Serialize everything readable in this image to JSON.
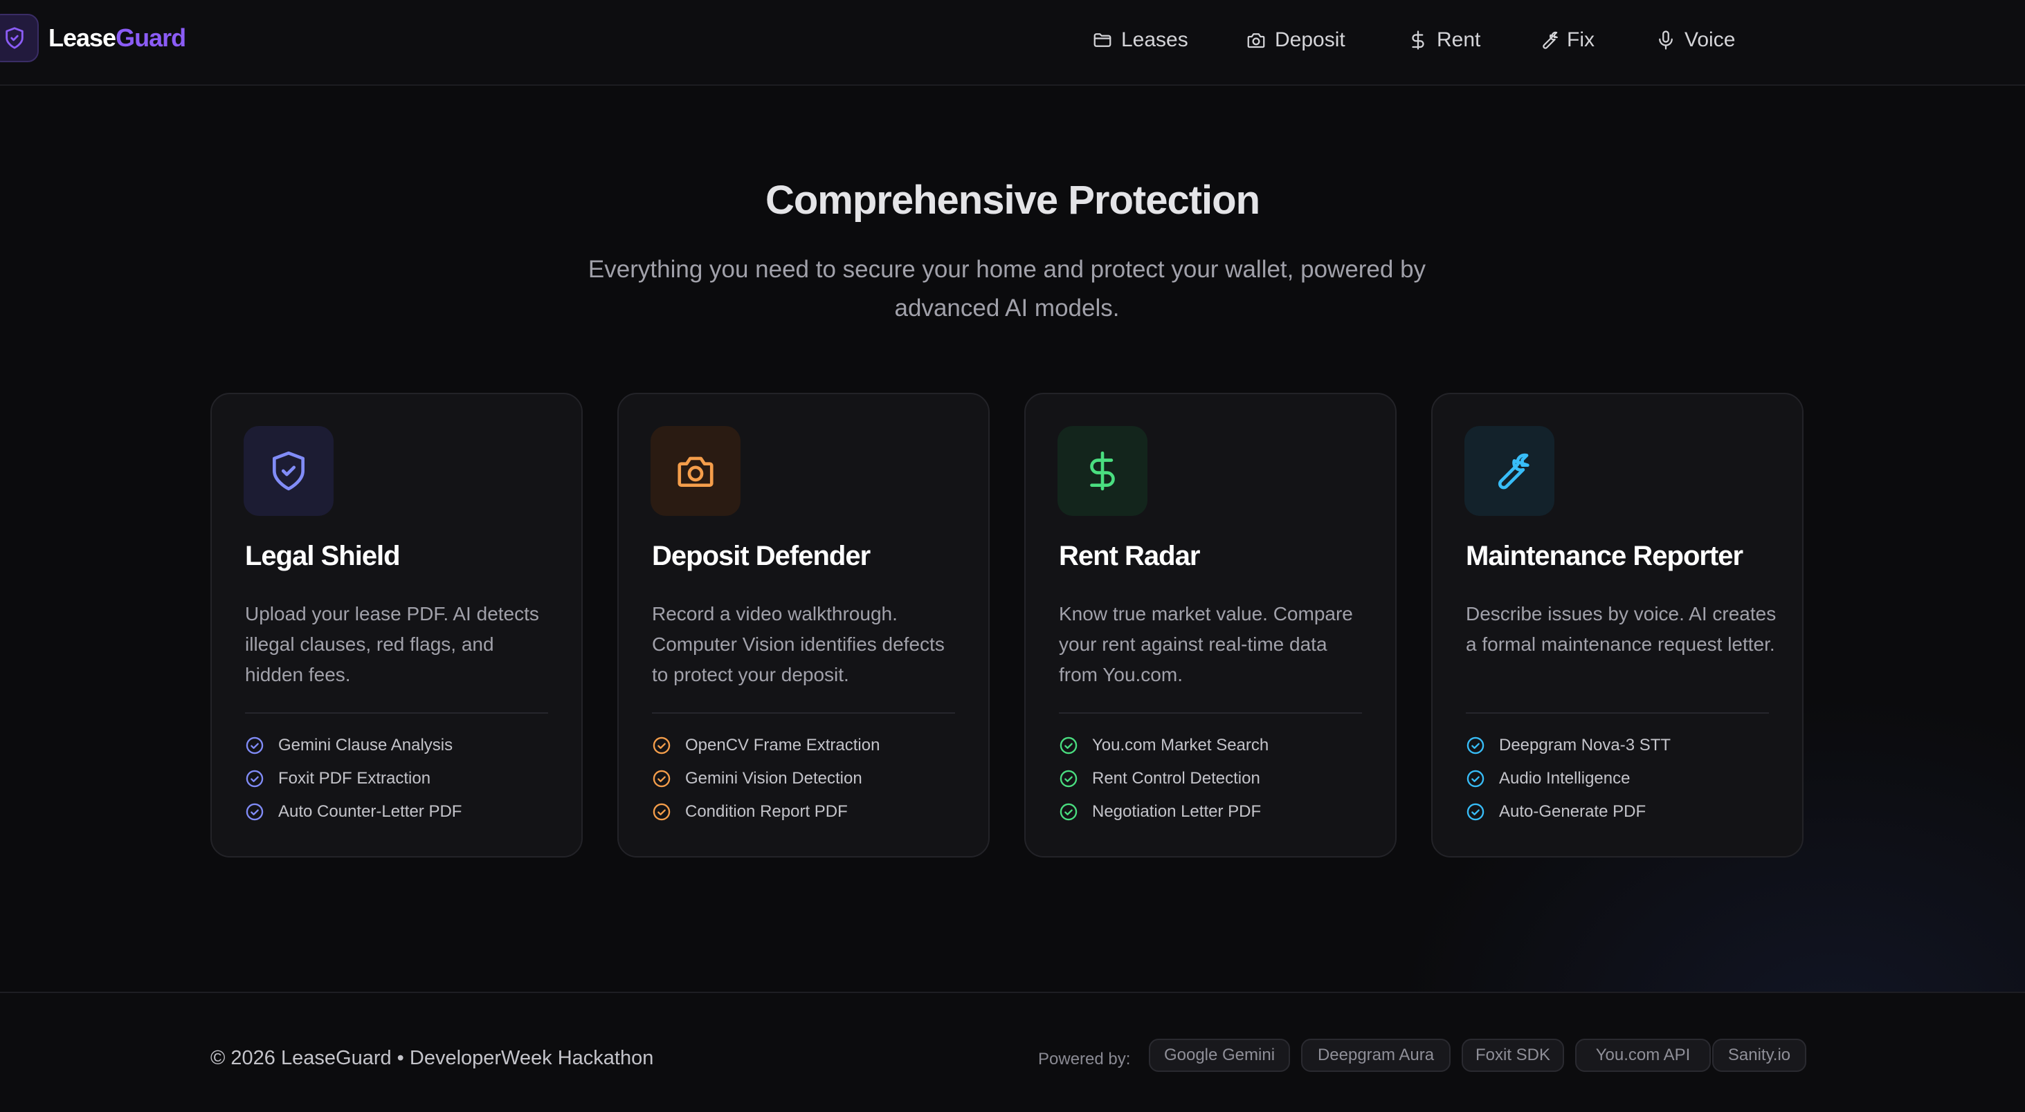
{
  "header": {
    "brand_part1": "Lease",
    "brand_part2": "Guard",
    "nav": [
      {
        "label": "Leases",
        "icon": "folder-icon"
      },
      {
        "label": "Deposit",
        "icon": "camera-icon"
      },
      {
        "label": "Rent",
        "icon": "dollar-icon"
      },
      {
        "label": "Fix",
        "icon": "wrench-icon"
      },
      {
        "label": "Voice",
        "icon": "microphone-icon"
      }
    ]
  },
  "hero": {
    "title": "Comprehensive Protection",
    "subtitle": "Everything you need to secure your home and protect your wallet, powered by advanced AI models."
  },
  "cards": [
    {
      "title": "Legal Shield",
      "icon": "shield-check-icon",
      "accent": "#818cf8",
      "description": "Upload your lease PDF. AI detects illegal clauses, red flags, and hidden fees.",
      "features": [
        "Gemini Clause Analysis",
        "Foxit PDF Extraction",
        "Auto Counter-Letter PDF"
      ]
    },
    {
      "title": "Deposit Defender",
      "icon": "camera-icon",
      "accent": "#f59e4b",
      "description": "Record a video walkthrough. Computer Vision identifies defects to protect your deposit.",
      "features": [
        "OpenCV Frame Extraction",
        "Gemini Vision Detection",
        "Condition Report PDF"
      ]
    },
    {
      "title": "Rent Radar",
      "icon": "dollar-icon",
      "accent": "#4ade80",
      "description": "Know true market value. Compare your rent against real-time data from You.com.",
      "features": [
        "You.com Market Search",
        "Rent Control Detection",
        "Negotiation Letter PDF"
      ]
    },
    {
      "title": "Maintenance Reporter",
      "icon": "wrench-icon",
      "accent": "#38bdf8",
      "description": "Describe issues by voice. AI creates a formal maintenance request letter.",
      "features": [
        "Deepgram Nova-3 STT",
        "Audio Intelligence",
        "Auto-Generate PDF"
      ]
    }
  ],
  "footer": {
    "copyright": "© 2026 LeaseGuard • DeveloperWeek Hackathon",
    "powered_by": "Powered by:",
    "tech": [
      "Google Gemini",
      "Deepgram Aura",
      "Foxit SDK",
      "You.com API",
      "Sanity.io"
    ]
  },
  "colors": {
    "brand_purple": "#8b5cf6",
    "background": "#0b0b0d",
    "card_background": "#131316"
  }
}
